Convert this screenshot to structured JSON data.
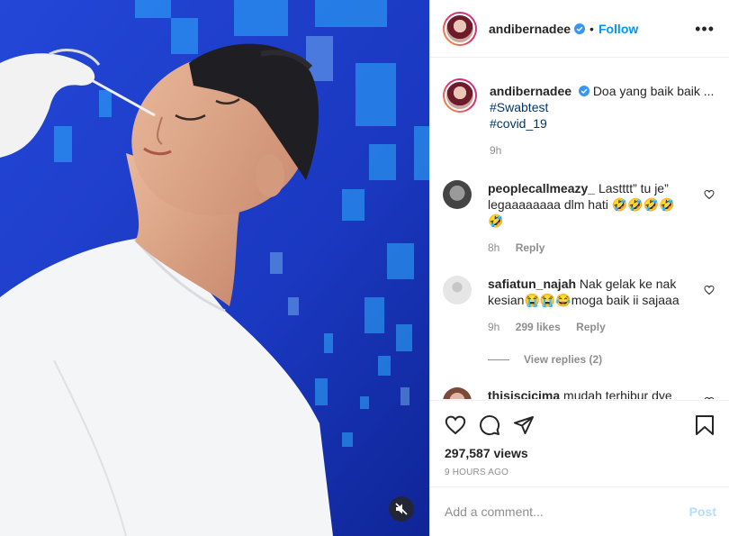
{
  "header": {
    "username": "andibernadee",
    "separator": "•",
    "follow_label": "Follow",
    "more_icon": "more-horizontal-icon"
  },
  "caption": {
    "username": "andibernadee",
    "text": "Doa yang baik baik ...",
    "hashtags": [
      "#Swabtest",
      "#covid_19"
    ],
    "time": "9h"
  },
  "comments": [
    {
      "username": "peoplecallmeazy_",
      "text_line1": "Lastttt” tu je”",
      "text_line2": "legaaaaaaaa dlm hati 🤣🤣🤣🤣",
      "text_line3": "🤣",
      "time": "8h",
      "reply_label": "Reply"
    },
    {
      "username": "safiatun_najah",
      "text_line1": "Nak gelak ke nak",
      "text_line2": "kesian😭😭😂moga baik ii sajaaa",
      "time": "9h",
      "likes": "299 likes",
      "reply_label": "Reply",
      "view_replies": "View replies (2)"
    },
    {
      "username": "thisiscicima",
      "text_line1": "mudah terhibur dye"
    }
  ],
  "stats": {
    "views": "297,587 views",
    "time_ago": "9 HOURS AGO"
  },
  "composer": {
    "placeholder": "Add a comment...",
    "post_label": "Post"
  },
  "colors": {
    "accent": "#0095f6",
    "link": "#00376b",
    "muted": "#8e8e8e",
    "post_disabled": "#b2dffc"
  }
}
